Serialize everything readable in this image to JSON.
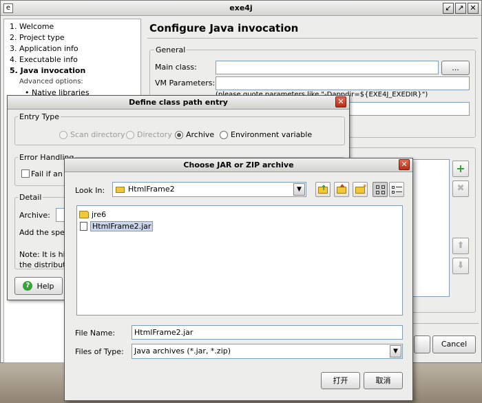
{
  "main_window": {
    "title": "exe4j",
    "app_icon": "app-icon",
    "controls": {
      "minimize": "↙",
      "maximize": "↗",
      "close": "✕"
    },
    "steps": [
      "1. Welcome",
      "2. Project type",
      "3. Application info",
      "4. Executable info",
      "5. Java invocation"
    ],
    "advanced_header": "Advanced options:",
    "advanced_item": "Native libraries",
    "page_title": "Configure Java invocation",
    "general_label": "General",
    "main_class_label": "Main class:",
    "browse_label": "...",
    "vm_params_label": "VM Parameters:",
    "vm_hint": "(please quote parameters like \"-Dappdir=${EXE4J_EXEDIR}\")",
    "cancel_label": "Cancel",
    "side_buttons": {
      "add": "+",
      "remove": "✖",
      "up": "⬆",
      "down": "⬇"
    },
    "accent_color": "#3aa63a"
  },
  "define_dialog": {
    "title": "Define class path entry",
    "entry_type_label": "Entry Type",
    "options": [
      "Scan directory",
      "Directory",
      "Archive",
      "Environment variable"
    ],
    "selected_option": "Archive",
    "error_handling_label": "Error Handling",
    "fail_text": "Fail if an e",
    "detail_label": "Detail",
    "archive_label": "Archive:",
    "add_text": "Add the spec",
    "note_line1": "Note: It is high",
    "note_line2": "the distributio",
    "help_label": "Help"
  },
  "choose_dialog": {
    "title": "Choose JAR or ZIP archive",
    "look_in_label": "Look In:",
    "look_in_value": "HtmlFrame2",
    "toolbar_icons": [
      "up-folder-icon",
      "home-icon",
      "new-folder-icon",
      "list-view-icon",
      "details-view-icon"
    ],
    "files": [
      {
        "name": "jre6",
        "type": "folder",
        "selected": false
      },
      {
        "name": "HtmlFrame2.jar",
        "type": "file",
        "selected": true
      }
    ],
    "file_name_label": "File Name:",
    "file_name_value": "HtmlFrame2.jar",
    "files_of_type_label": "Files of Type:",
    "files_of_type_value": "Java archives (*.jar, *.zip)",
    "open_label": "打开",
    "cancel_label": "取消"
  }
}
